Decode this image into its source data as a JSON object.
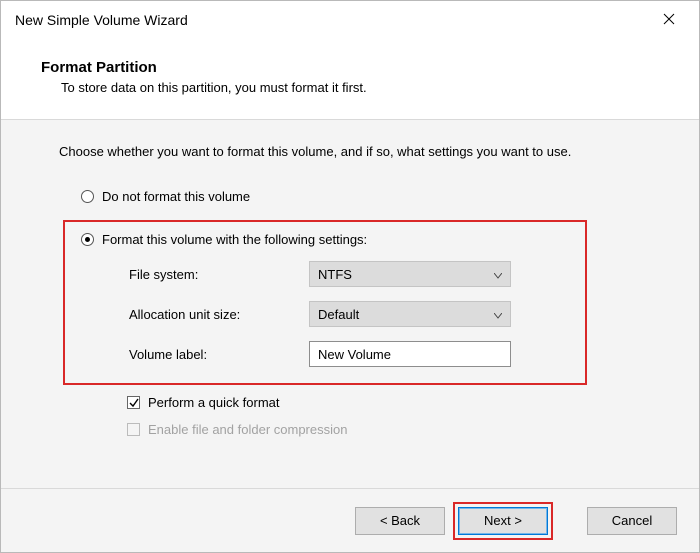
{
  "window": {
    "title": "New Simple Volume Wizard"
  },
  "header": {
    "title": "Format Partition",
    "subtitle": "To store data on this partition, you must format it first."
  },
  "intro": "Choose whether you want to format this volume, and if so, what settings you want to use.",
  "options": {
    "no_format": "Do not format this volume",
    "do_format": "Format this volume with the following settings:"
  },
  "fields": {
    "fs_label": "File system:",
    "fs_value": "NTFS",
    "au_label": "Allocation unit size:",
    "au_value": "Default",
    "vl_label": "Volume label:",
    "vl_value": "New Volume"
  },
  "checks": {
    "quick": "Perform a quick format",
    "compress": "Enable file and folder compression"
  },
  "buttons": {
    "back": "< Back",
    "next": "Next >",
    "cancel": "Cancel"
  }
}
